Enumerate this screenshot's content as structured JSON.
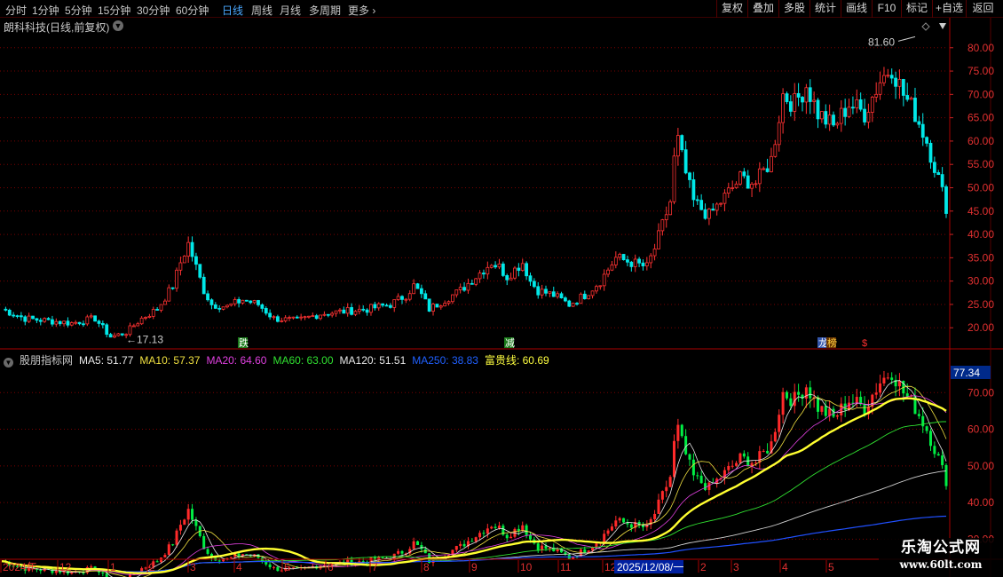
{
  "toolbar": {
    "periods": [
      {
        "label": "分时"
      },
      {
        "label": "1分钟"
      },
      {
        "label": "5分钟"
      },
      {
        "label": "15分钟"
      },
      {
        "label": "30分钟"
      },
      {
        "label": "60分钟"
      },
      {
        "label": "日线"
      },
      {
        "label": "周线"
      },
      {
        "label": "月线"
      },
      {
        "label": "多周期"
      },
      {
        "label": "更多"
      }
    ],
    "active_period": "日线",
    "more_icon": "chevron-right-icon",
    "buttons": [
      {
        "label": "复权"
      },
      {
        "label": "叠加"
      },
      {
        "label": "多股"
      },
      {
        "label": "统计"
      },
      {
        "label": "画线"
      },
      {
        "label": "F10"
      },
      {
        "label": "标记"
      },
      {
        "label": "+自选"
      },
      {
        "label": "返回"
      }
    ]
  },
  "stock": {
    "title": "朗科科技(日线,前复权)",
    "high_label": "81.60",
    "low_label": "17.13",
    "markers": [
      {
        "text": "跌",
        "color": "#ffffff",
        "bg": "#1a7a1a"
      },
      {
        "text": "减",
        "color": "#ffffff",
        "bg": "#1a7a1a"
      },
      {
        "text": "龙",
        "color": "#ffffff",
        "bg": "#3355aa"
      },
      {
        "text": "榜",
        "color": "#ffd040",
        "bg": "#663300"
      },
      {
        "text": "$",
        "color": "#ff3030",
        "bg": "#000000"
      }
    ]
  },
  "price_axis": {
    "ticks": [
      "80.00",
      "75.00",
      "70.00",
      "65.00",
      "60.00",
      "55.00",
      "50.00",
      "45.00",
      "40.00",
      "35.00",
      "30.00",
      "25.00",
      "20.00"
    ]
  },
  "indicator": {
    "name": "股朋指标网",
    "items": [
      {
        "label": "MA5: 51.77",
        "color": "#e8e8e8"
      },
      {
        "label": "MA10: 57.37",
        "color": "#f0e040"
      },
      {
        "label": "MA20: 64.60",
        "color": "#e040e0"
      },
      {
        "label": "MA60: 63.00",
        "color": "#30e030"
      },
      {
        "label": "MA120: 51.51",
        "color": "#e8e8e8"
      },
      {
        "label": "MA250: 38.83",
        "color": "#2060ff"
      },
      {
        "label": "富贵线: 60.69",
        "color": "#ffff40"
      }
    ],
    "axis_top": "77.34",
    "axis_ticks": [
      "70.00",
      "60.00",
      "50.00",
      "40.00",
      "30.00"
    ]
  },
  "time_axis": {
    "labels": [
      "2024年",
      "12",
      "1",
      "2",
      "3",
      "4",
      "5",
      "6",
      "7",
      "8",
      "9",
      "10",
      "11",
      "12",
      "2",
      "3",
      "4",
      "5"
    ],
    "cursor_label": "2025/12/08/一"
  },
  "watermark": {
    "line1": "乐淘公式网",
    "line2": "www.60lt.com"
  },
  "colors": {
    "up": "#ff3232",
    "down": "#00e8e8",
    "grid": "#7a0000",
    "background": "#000000",
    "active": "#4aa8ff"
  },
  "chart_data": {
    "type": "candlestick",
    "upper_ylim": [
      17,
      83
    ],
    "lower_ylim": [
      25,
      77.34
    ],
    "close_path_approx": [
      [
        0,
        24
      ],
      [
        6,
        22
      ],
      [
        12,
        21.5
      ],
      [
        18,
        21
      ],
      [
        24,
        22
      ],
      [
        28,
        18
      ],
      [
        32,
        19
      ],
      [
        36,
        22
      ],
      [
        40,
        24
      ],
      [
        44,
        29
      ],
      [
        46,
        34
      ],
      [
        48,
        38
      ],
      [
        50,
        33
      ],
      [
        52,
        28
      ],
      [
        54,
        25
      ],
      [
        58,
        24.5
      ],
      [
        62,
        26
      ],
      [
        66,
        25
      ],
      [
        70,
        22
      ],
      [
        76,
        21.5
      ],
      [
        82,
        23
      ],
      [
        88,
        23.5
      ],
      [
        94,
        24
      ],
      [
        100,
        25
      ],
      [
        104,
        27
      ],
      [
        106,
        29
      ],
      [
        108,
        27
      ],
      [
        110,
        24
      ],
      [
        114,
        26
      ],
      [
        118,
        28
      ],
      [
        122,
        31
      ],
      [
        126,
        34
      ],
      [
        128,
        33
      ],
      [
        130,
        31
      ],
      [
        134,
        34
      ],
      [
        136,
        30
      ],
      [
        138,
        28
      ],
      [
        142,
        27
      ],
      [
        146,
        25
      ],
      [
        150,
        27
      ],
      [
        154,
        30
      ],
      [
        158,
        35
      ],
      [
        162,
        34
      ],
      [
        166,
        33
      ],
      [
        168,
        37
      ],
      [
        170,
        42
      ],
      [
        172,
        47
      ],
      [
        173,
        56
      ],
      [
        174,
        60
      ],
      [
        176,
        53
      ],
      [
        178,
        47
      ],
      [
        182,
        44
      ],
      [
        186,
        48
      ],
      [
        190,
        52
      ],
      [
        194,
        51
      ],
      [
        198,
        56
      ],
      [
        201,
        70
      ],
      [
        204,
        68
      ],
      [
        207,
        72
      ],
      [
        210,
        66
      ],
      [
        214,
        63
      ],
      [
        218,
        68
      ],
      [
        222,
        66
      ],
      [
        226,
        73
      ],
      [
        229,
        76
      ],
      [
        232,
        70
      ],
      [
        235,
        66
      ],
      [
        238,
        60
      ],
      [
        241,
        52
      ],
      [
        243,
        46
      ]
    ]
  }
}
